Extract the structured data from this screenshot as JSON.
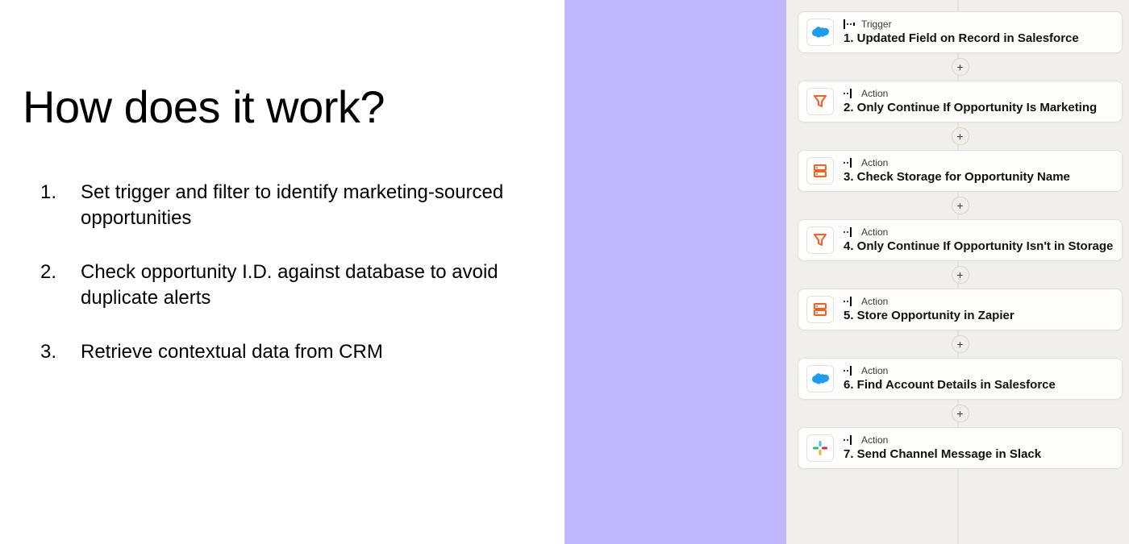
{
  "left": {
    "title": "How does it work?",
    "items": [
      "Set trigger and filter to identify marketing-sourced opportunities",
      "Check opportunity I.D. against database to avoid duplicate alerts",
      "Retrieve contextual data from CRM"
    ]
  },
  "kind": {
    "trigger": "Trigger",
    "action": "Action"
  },
  "steps": [
    {
      "icon": "salesforce",
      "kind": "trigger",
      "title": "1. Updated Field on Record in Salesforce"
    },
    {
      "icon": "filter",
      "kind": "action",
      "title": "2. Only Continue If Opportunity Is Marketing"
    },
    {
      "icon": "storage",
      "kind": "action",
      "title": "3. Check Storage for Opportunity Name"
    },
    {
      "icon": "filter",
      "kind": "action",
      "title": "4. Only Continue If Opportunity Isn't in Storage"
    },
    {
      "icon": "storage",
      "kind": "action",
      "title": "5. Store Opportunity in Zapier"
    },
    {
      "icon": "salesforce",
      "kind": "action",
      "title": "6. Find Account Details in Salesforce"
    },
    {
      "icon": "slack",
      "kind": "action",
      "title": "7. Send Channel Message in Slack"
    }
  ]
}
